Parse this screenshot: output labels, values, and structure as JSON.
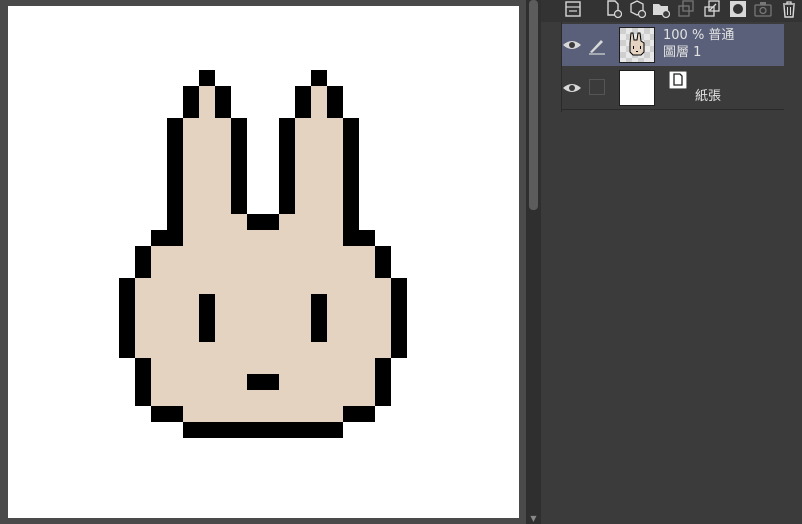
{
  "colors": {
    "fill": "#e5d3c1",
    "outline": "#000000",
    "selected_row": "#5a6079"
  },
  "layers": [
    {
      "opacity_mode": "100 % 普通",
      "name": "圖層 1",
      "selected": true,
      "thumbnail_icon": "rabbit-thumbnail"
    },
    {
      "name": "紙張",
      "selected": false,
      "thumbnail_icon": "paper-icon"
    }
  ],
  "toolbar_icons": [
    "layer-property-icon",
    "new-raster-layer-icon",
    "new-vector-layer-icon",
    "new-folder-icon",
    "copy-layer-icon",
    "merge-down-icon",
    "layer-mask-icon",
    "camera-icon",
    "trash-icon"
  ]
}
